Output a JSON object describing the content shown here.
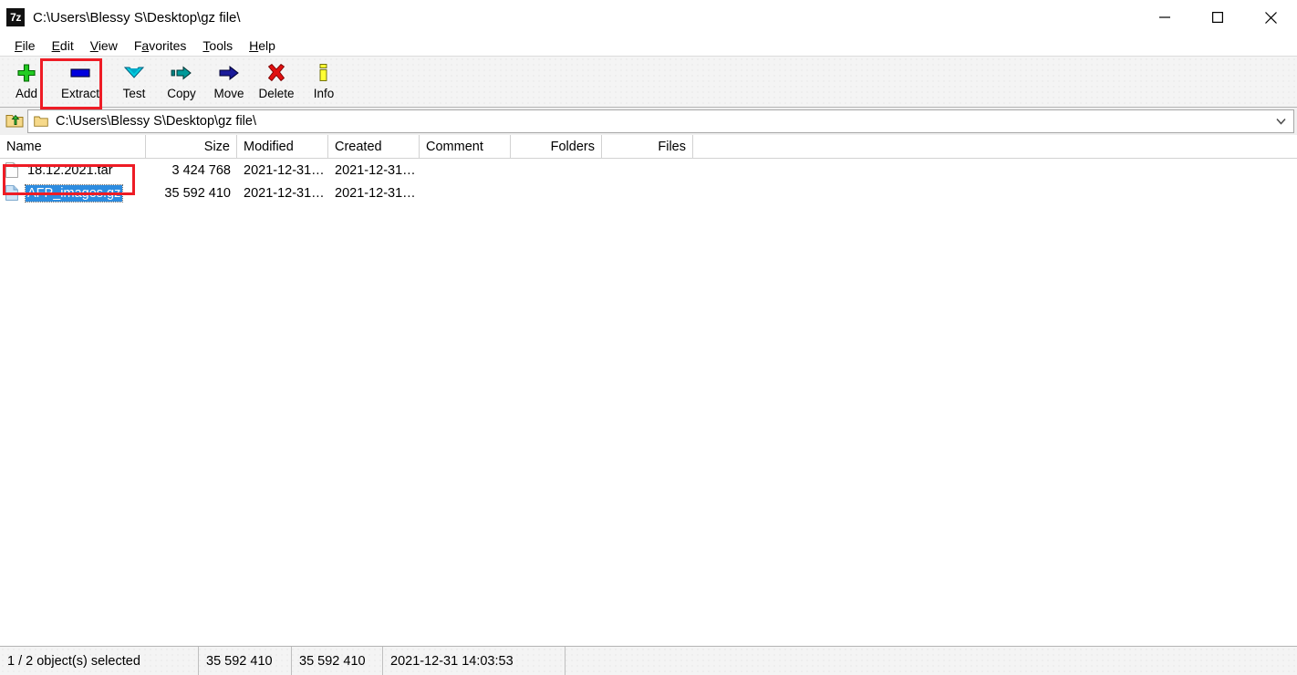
{
  "window": {
    "title": "C:\\Users\\Blessy S\\Desktop\\gz file\\",
    "app_icon": "7z",
    "controls": {
      "minimize": "minimize-icon",
      "maximize": "maximize-icon",
      "close": "close-icon"
    }
  },
  "menubar": {
    "items": [
      {
        "label": "File",
        "accel_index": 0
      },
      {
        "label": "Edit",
        "accel_index": 0
      },
      {
        "label": "View",
        "accel_index": 0
      },
      {
        "label": "Favorites",
        "accel_index": 1
      },
      {
        "label": "Tools",
        "accel_index": 0
      },
      {
        "label": "Help",
        "accel_index": 0
      }
    ]
  },
  "toolbar": {
    "buttons": [
      {
        "label": "Add",
        "icon": "plus-icon",
        "color": "#22bb22"
      },
      {
        "label": "Extract",
        "icon": "extract-bar-icon",
        "color": "#0000dd"
      },
      {
        "label": "Test",
        "icon": "chevron-down-icon",
        "color": "#00c8d7"
      },
      {
        "label": "Copy",
        "icon": "copy-arrow-icon",
        "color": "#00807f"
      },
      {
        "label": "Move",
        "icon": "move-arrow-icon",
        "color": "#13137f"
      },
      {
        "label": "Delete",
        "icon": "cross-icon",
        "color": "#dd0000"
      },
      {
        "label": "Info",
        "icon": "info-icon",
        "color": "#ffff00"
      }
    ],
    "highlighted": "Extract"
  },
  "address": {
    "up_icon": "folder-up-icon",
    "folder_icon": "folder-icon",
    "path": "C:\\Users\\Blessy S\\Desktop\\gz file\\",
    "dropdown_icon": "chevron-down-icon"
  },
  "filelist": {
    "columns": [
      {
        "label": "Name",
        "align": "left"
      },
      {
        "label": "Size",
        "align": "right"
      },
      {
        "label": "Modified",
        "align": "left"
      },
      {
        "label": "Created",
        "align": "left"
      },
      {
        "label": "Comment",
        "align": "left"
      },
      {
        "label": "Folders",
        "align": "right"
      },
      {
        "label": "Files",
        "align": "right"
      }
    ],
    "rows": [
      {
        "name": "18.12.2021.tar",
        "size": "3 424 768",
        "modified": "2021-12-31…",
        "created": "2021-12-31…",
        "icon": "file-tar-icon",
        "selected": false
      },
      {
        "name": "AFP_images.gz",
        "size": "35 592 410",
        "modified": "2021-12-31…",
        "created": "2021-12-31…",
        "icon": "file-gz-icon",
        "selected": true
      }
    ]
  },
  "statusbar": {
    "selection": "1 / 2 object(s) selected",
    "selected_size": "35 592 410",
    "total_size": "35 592 410",
    "timestamp": "2021-12-31 14:03:53"
  },
  "annotations": {
    "highlight_color": "#ee1c25",
    "targets": [
      "extract-button",
      "selected-file-row"
    ]
  }
}
